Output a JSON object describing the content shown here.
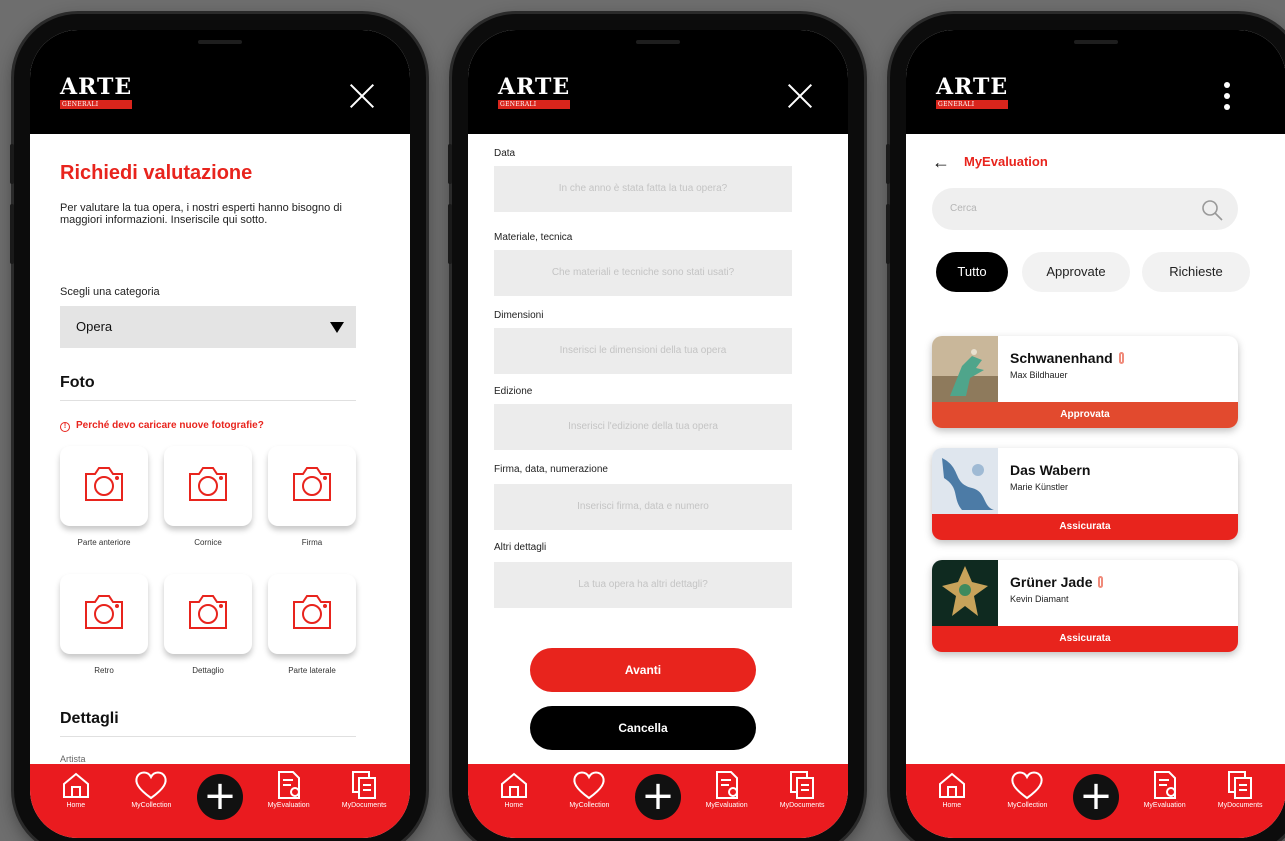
{
  "logo": {
    "word": "ARTE",
    "sub": "GENERALI"
  },
  "nav": {
    "home": "Home",
    "collection": "MyCollection",
    "add": "+",
    "evaluation": "MyEvaluation",
    "documents": "MyDocuments"
  },
  "screen1": {
    "title": "Richiedi valutazione",
    "intro": "Per valutare la tua opera, i nostri esperti hanno bisogno di maggiori informazioni. Inseriscile qui sotto.",
    "category_label": "Scegli una categoria",
    "category_value": "Opera",
    "foto_header": "Foto",
    "why_link": "Perché devo caricare nuove fotografie?",
    "photo_slots": [
      "Parte anteriore",
      "Cornice",
      "Firma",
      "Retro",
      "Dettaglio",
      "Parte laterale"
    ],
    "dettagli_header": "Dettagli",
    "artista_label": "Artista"
  },
  "screen2": {
    "fields": [
      {
        "label": "Data",
        "placeholder": "In che anno è stata fatta la tua opera?"
      },
      {
        "label": "Materiale, tecnica",
        "placeholder": "Che materiali e tecniche sono stati usati?"
      },
      {
        "label": "Dimensioni",
        "placeholder": "Inserisci le dimensioni della tua opera"
      },
      {
        "label": "Edizione",
        "placeholder": "Inserisci l'edizione della tua opera"
      },
      {
        "label": "Firma, data, numerazione",
        "placeholder": "Inserisci firma, data e numero"
      },
      {
        "label": "Altri dettagli",
        "placeholder": "La tua opera ha altri dettagli?"
      }
    ],
    "next_label": "Avanti",
    "cancel_label": "Cancella"
  },
  "screen3": {
    "title": "MyEvaluation",
    "search_placeholder": "Cerca",
    "filters": [
      "Tutto",
      "Approvate",
      "Richieste"
    ],
    "items": [
      {
        "name": "Schwanenhand",
        "artist": "Max Bildhauer",
        "status": "Approvata",
        "tagged": true
      },
      {
        "name": "Das Wabern",
        "artist": "Marie Künstler",
        "status": "Assicurata",
        "tagged": false
      },
      {
        "name": "Grüner Jade",
        "artist": "Kevin Diamant",
        "status": "Assicurata",
        "tagged": true
      }
    ]
  },
  "colors": {
    "accent": "#e8241d",
    "bar": "#000000",
    "nav": "#ea1b1f"
  },
  "icons": [
    "close-icon",
    "camera-icon",
    "info-icon",
    "caret-down-icon",
    "home-icon",
    "heart-icon",
    "plus-icon",
    "evaluation-icon",
    "documents-icon",
    "back-arrow-icon",
    "search-icon",
    "kebab-menu-icon",
    "tag-icon"
  ]
}
